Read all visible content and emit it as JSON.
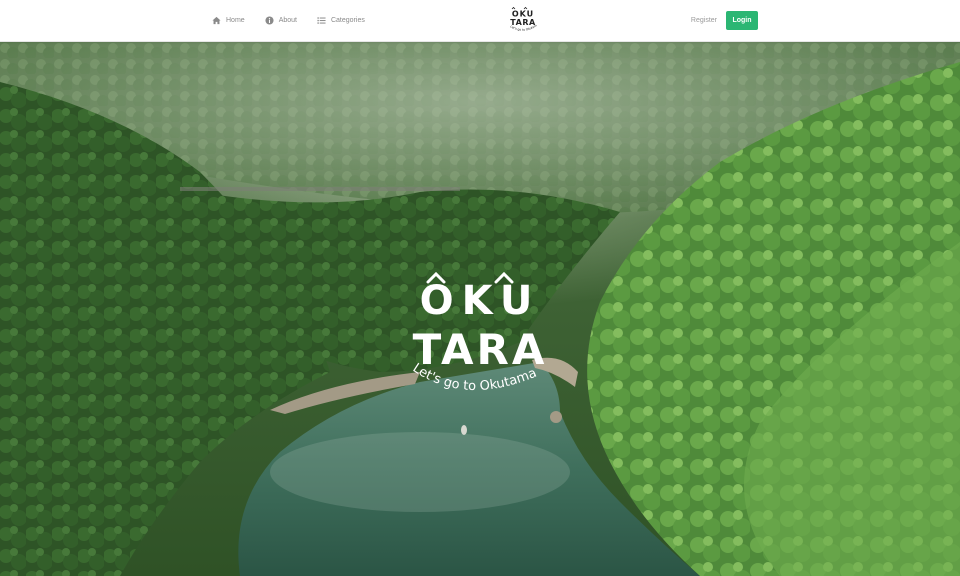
{
  "nav": {
    "home_label": "Home",
    "about_label": "About",
    "categories_label": "Categories",
    "register_label": "Register",
    "login_label": "Login"
  },
  "brand": {
    "line1": "OKU",
    "line2": "TARA",
    "tagline": "Let's go to Okutama"
  },
  "hero_logo": {
    "line1": "OKU",
    "line2": "TARA",
    "tagline": "Let's go to Okutama"
  },
  "colors": {
    "accent": "#2bb673",
    "nav_text": "#8a8a8a",
    "forest_dark": "#2f5226",
    "river": "#3f6f5c"
  },
  "icons": {
    "home": "home-icon",
    "about": "info-circle-icon",
    "categories": "list-icon"
  }
}
